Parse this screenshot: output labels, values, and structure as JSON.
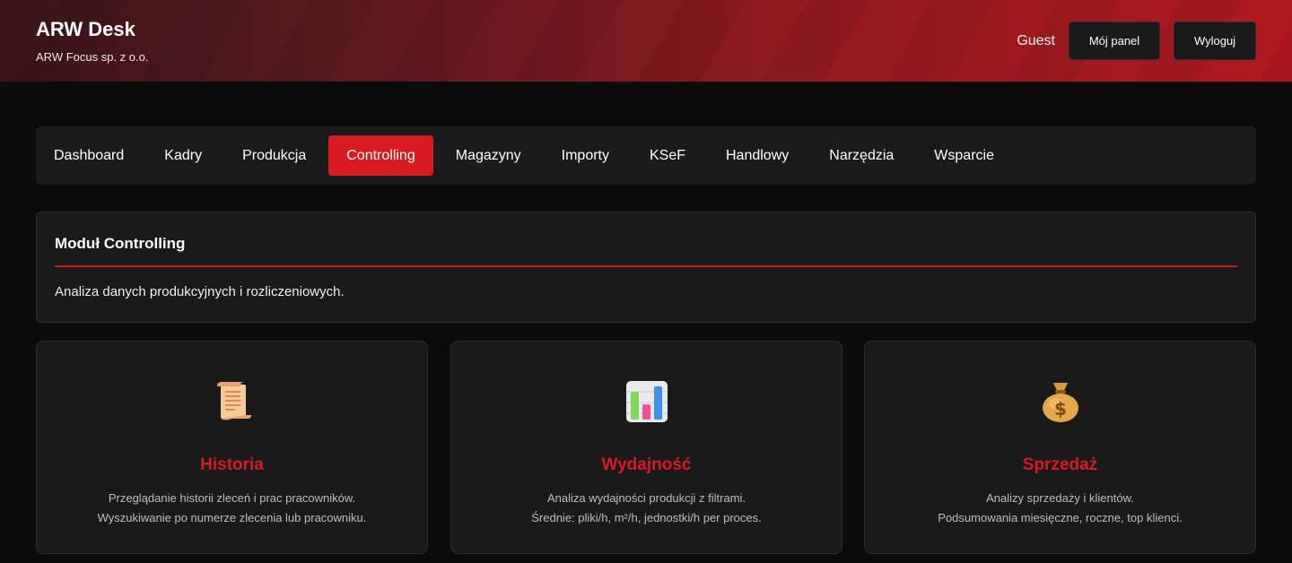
{
  "header": {
    "title": "ARW Desk",
    "subtitle": "ARW Focus sp. z o.o.",
    "user": "Guest",
    "panel_label": "Mój panel",
    "logout_label": "Wyloguj"
  },
  "nav": {
    "items": [
      {
        "label": "Dashboard"
      },
      {
        "label": "Kadry"
      },
      {
        "label": "Produkcja"
      },
      {
        "label": "Controlling",
        "active": true
      },
      {
        "label": "Magazyny"
      },
      {
        "label": "Importy"
      },
      {
        "label": "KSeF"
      },
      {
        "label": "Handlowy"
      },
      {
        "label": "Narzędzia"
      },
      {
        "label": "Wsparcie"
      }
    ]
  },
  "module": {
    "title": "Moduł Controlling",
    "description": "Analiza danych produkcyjnych i rozliczeniowych."
  },
  "cards": [
    {
      "icon": "scroll-icon",
      "title": "Historia",
      "line1": "Przeglądanie historii zleceń i prac pracowników.",
      "line2": "Wyszukiwanie po numerze zlecenia lub pracowniku."
    },
    {
      "icon": "bar-chart-icon",
      "title": "Wydajność",
      "line1": "Analiza wydajności produkcji z filtrami.",
      "line2": "Średnie: pliki/h, m²/h, jednostki/h per proces."
    },
    {
      "icon": "money-bag-icon",
      "title": "Sprzedaż",
      "line1": "Analizy sprzedaży i klientów.",
      "line2": "Podsumowania miesięczne, roczne, top klienci."
    }
  ],
  "colors": {
    "accent": "#d81b22",
    "background": "#0b0b0b",
    "panel": "#1a1a1a"
  }
}
